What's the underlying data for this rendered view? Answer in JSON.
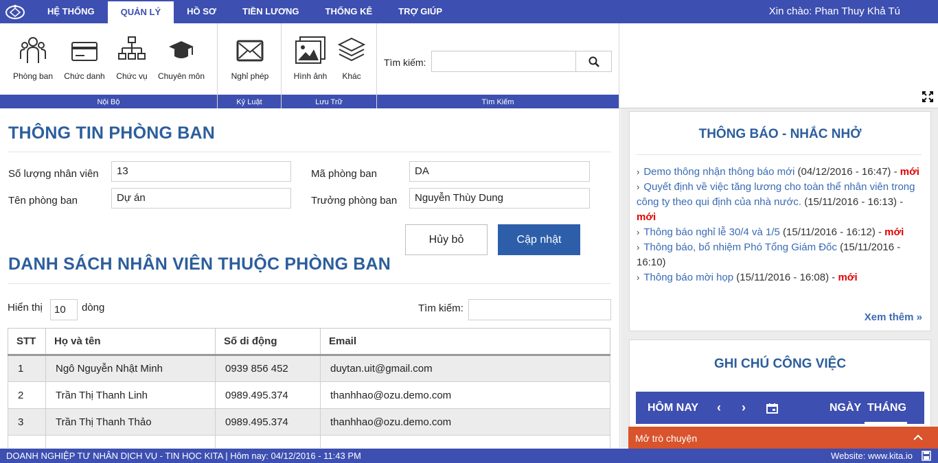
{
  "topbar": {
    "menu": [
      "HỆ THỐNG",
      "QUẢN LÝ",
      "HỒ SƠ",
      "TIỀN LƯƠNG",
      "THỐNG KÊ",
      "TRỢ GIÚP"
    ],
    "greeting": "Xin chào: Phan Thuy Khả Tú"
  },
  "ribbon": {
    "groups": [
      "Nội Bộ",
      "Kỷ Luật",
      "Lưu Trữ",
      "Tìm Kiếm"
    ],
    "buttons": [
      "Phòng ban",
      "Chức danh",
      "Chức vụ",
      "Chuyên môn",
      "Nghỉ phép",
      "Hình ảnh",
      "Khác"
    ],
    "search_label": "Tìm kiếm:"
  },
  "dept": {
    "title": "THÔNG TIN PHÒNG BAN",
    "staff_count_label": "Số lượng nhân viên",
    "staff_count": "13",
    "code_label": "Mã phòng ban",
    "code": "DA",
    "name_label": "Tên phòng ban",
    "name": "Dự án",
    "head_label": "Trưởng phòng ban",
    "head": "Nguyễn Thùy Dung",
    "cancel": "Hủy bỏ",
    "update": "Cập nhật"
  },
  "staff": {
    "title": "DANH SÁCH NHÂN VIÊN THUỘC PHÒNG BAN",
    "show_label": "Hiển thị",
    "show_value": "10",
    "rows_label": "dòng",
    "search_label": "Tìm kiếm:",
    "columns": [
      "STT",
      "Họ và tên",
      "Số di động",
      "Email"
    ],
    "rows": [
      [
        "1",
        "Ngô Nguyễn Nhật Minh",
        "0939 856 452",
        "duytan.uit@gmail.com"
      ],
      [
        "2",
        "Trần Thị Thanh Linh",
        "0989.495.374",
        "thanhhao@ozu.demo.com"
      ],
      [
        "3",
        "Trần Thị Thanh Thảo",
        "0989.495.374",
        "thanhhao@ozu.demo.com"
      ]
    ]
  },
  "notices": {
    "title": "THÔNG BÁO - NHẮC NHỞ",
    "items": [
      {
        "title": "Demo thông nhận thông báo mới",
        "date": "(04/12/2016 - 16:47) -",
        "tag": "mới"
      },
      {
        "title": "Quyết định về việc tăng lương cho toàn thể nhân viên trong công ty theo qui định của nhà nước.",
        "date": "(15/11/2016 - 16:13) -",
        "tag": "mới"
      },
      {
        "title": "Thông báo nghỉ lễ 30/4 và 1/5",
        "date": "(15/11/2016 - 16:12) -",
        "tag": "mới"
      },
      {
        "title": "Thông báo, bổ nhiệm Phó Tổng Giám Đốc",
        "date": "(15/11/2016 - 16:10)",
        "tag": ""
      },
      {
        "title": "Thông báo mời họp",
        "date": "(15/11/2016 - 16:08) -",
        "tag": "mới"
      }
    ],
    "more": "Xem thêm"
  },
  "tasks": {
    "title": "GHI CHÚ CÔNG VIỆC",
    "today": "HÔM NAY",
    "day": "NGÀY",
    "month": "THÁNG"
  },
  "chat": {
    "label": "Mở trò chuyện"
  },
  "footer": {
    "left": "DOANH NGHIỆP TƯ NHÂN DỊCH VỤ - TIN HỌC KITA | Hôm nay: 04/12/2016 - 11:43 PM",
    "right": "Website: www.kita.io"
  }
}
